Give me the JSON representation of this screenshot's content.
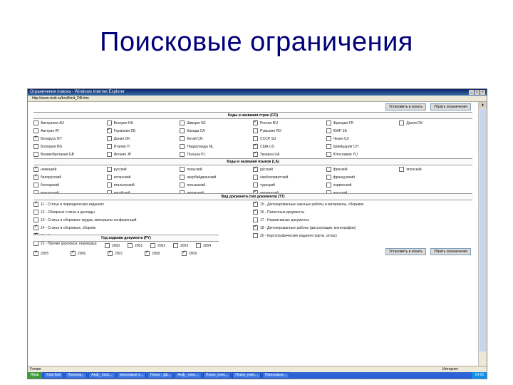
{
  "slide_title": "Поисковые ограничения",
  "window": {
    "title": "Ограничения поиска - Windows Internet Explorer",
    "address": "http://www.viniti.ru/bnd/limit_DB.htm",
    "controls": [
      "_",
      "□",
      "×"
    ]
  },
  "buttons": {
    "top_apply": "Установить и искать",
    "top_reset": "Убрать ограничения",
    "bottom_apply": "Установить и искать",
    "bottom_reset": "Убрать ограничения"
  },
  "sections": {
    "countries": {
      "title": "Коды и названия стран (CO)",
      "items": [
        {
          "label": "Австралия AU",
          "checked": false
        },
        {
          "label": "Венгрия HU",
          "checked": false
        },
        {
          "label": "Швеция SE",
          "checked": false
        },
        {
          "label": "Россия RU",
          "checked": true
        },
        {
          "label": "Франция FR",
          "checked": false
        },
        {
          "label": "Дания DK",
          "checked": false
        },
        {
          "label": "Австрия AT",
          "checked": false
        },
        {
          "label": "Германия DE",
          "checked": true
        },
        {
          "label": "Канада CA",
          "checked": false
        },
        {
          "label": "Румыния RO",
          "checked": false
        },
        {
          "label": "ЮАР ZA",
          "checked": false
        },
        {
          "label": "",
          "checked": null
        },
        {
          "label": "Беларусь BY",
          "checked": true
        },
        {
          "label": "Дания DK",
          "checked": false
        },
        {
          "label": "Китай CN",
          "checked": false
        },
        {
          "label": "СССР SU",
          "checked": false
        },
        {
          "label": "Чехия CZ",
          "checked": false
        },
        {
          "label": "",
          "checked": null
        },
        {
          "label": "Болгария BG",
          "checked": false
        },
        {
          "label": "Италия IT",
          "checked": false
        },
        {
          "label": "Нидерланды NL",
          "checked": false
        },
        {
          "label": "США US",
          "checked": true
        },
        {
          "label": "Швейцария CH",
          "checked": false
        },
        {
          "label": "",
          "checked": null
        },
        {
          "label": "Великобритания GB",
          "checked": false
        },
        {
          "label": "Япония JP",
          "checked": false
        },
        {
          "label": "Польша PL",
          "checked": false
        },
        {
          "label": "Украина UA",
          "checked": true
        },
        {
          "label": "Югославия YU",
          "checked": false
        },
        {
          "label": "",
          "checked": null
        }
      ]
    },
    "languages": {
      "title": "Коды и названия языков (LA)",
      "items": [
        {
          "label": "немецкий",
          "checked": true
        },
        {
          "label": "русский",
          "checked": false
        },
        {
          "label": "польский",
          "checked": false
        },
        {
          "label": "русский",
          "checked": true
        },
        {
          "label": "финский",
          "checked": false
        },
        {
          "label": "японский",
          "checked": false
        },
        {
          "label": "белорусский",
          "checked": true
        },
        {
          "label": "испанский",
          "checked": false
        },
        {
          "label": "азербайджанский",
          "checked": false
        },
        {
          "label": "сербохорватский",
          "checked": false
        },
        {
          "label": "французский",
          "checked": false
        },
        {
          "label": "",
          "checked": null
        },
        {
          "label": "болгарский",
          "checked": false
        },
        {
          "label": "итальянский",
          "checked": false
        },
        {
          "label": "латышский",
          "checked": false
        },
        {
          "label": "турецкий",
          "checked": false
        },
        {
          "label": "хорватский",
          "checked": false
        },
        {
          "label": "",
          "checked": null
        },
        {
          "label": "венгерский",
          "checked": false
        },
        {
          "label": "китайский",
          "checked": false
        },
        {
          "label": "литовский",
          "checked": false
        },
        {
          "label": "украинский",
          "checked": true
        },
        {
          "label": "чешский",
          "checked": false
        },
        {
          "label": "",
          "checked": null
        }
      ]
    },
    "doctypes": {
      "title": "Вид документа (тип документа) (TT)",
      "items": [
        {
          "label": "11 - Статьи в периодических изданиях",
          "checked": true
        },
        {
          "label": "15 - Депонированные научные работы и материалы, сборники",
          "checked": true
        },
        {
          "label": "12 - Обзорные статьи и доклады",
          "checked": false
        },
        {
          "label": "16 - Патентные документы",
          "checked": true
        },
        {
          "label": "13 - Статьи в сборниках трудов, материалы конференций",
          "checked": false
        },
        {
          "label": "17 - Нормативные документы",
          "checked": false
        },
        {
          "label": "14 - Статьи в сборниках, сборник",
          "checked": true
        },
        {
          "label": "18 - Депонированные работы (диссертации, монографии)",
          "checked": true
        },
        {
          "label": "19 - Книги",
          "checked": true
        },
        {
          "label": "20 - Картографические издания (карты, атлас)",
          "checked": false
        },
        {
          "label": "21 - Прочие (рукописи, переводы)",
          "checked": false
        },
        {
          "label": "",
          "checked": null
        }
      ]
    },
    "years": {
      "title": "Год издания документа (PY)",
      "row1": [
        {
          "label": "2000",
          "checked": false
        },
        {
          "label": "2001",
          "checked": false
        },
        {
          "label": "2002",
          "checked": false
        },
        {
          "label": "2003",
          "checked": false
        },
        {
          "label": "2004",
          "checked": false
        }
      ],
      "row2": [
        {
          "label": "2005",
          "checked": true
        },
        {
          "label": "2006",
          "checked": true
        },
        {
          "label": "2007",
          "checked": true
        },
        {
          "label": "2008",
          "checked": true
        },
        {
          "label": "2009",
          "checked": true
        }
      ]
    }
  },
  "statusbar": {
    "left": "Готово",
    "right": "Интернет"
  },
  "taskbar": {
    "start": "Пуск",
    "items": [
      "Total Ball",
      "Поисков...",
      "Анф_ поис...",
      "поисковые о...",
      "Поиск - Дв...",
      "Анф_ поис...",
      "Поиск_поис...",
      "Поиск_поис...",
      "Поисковые..."
    ],
    "clock": "14:26"
  }
}
